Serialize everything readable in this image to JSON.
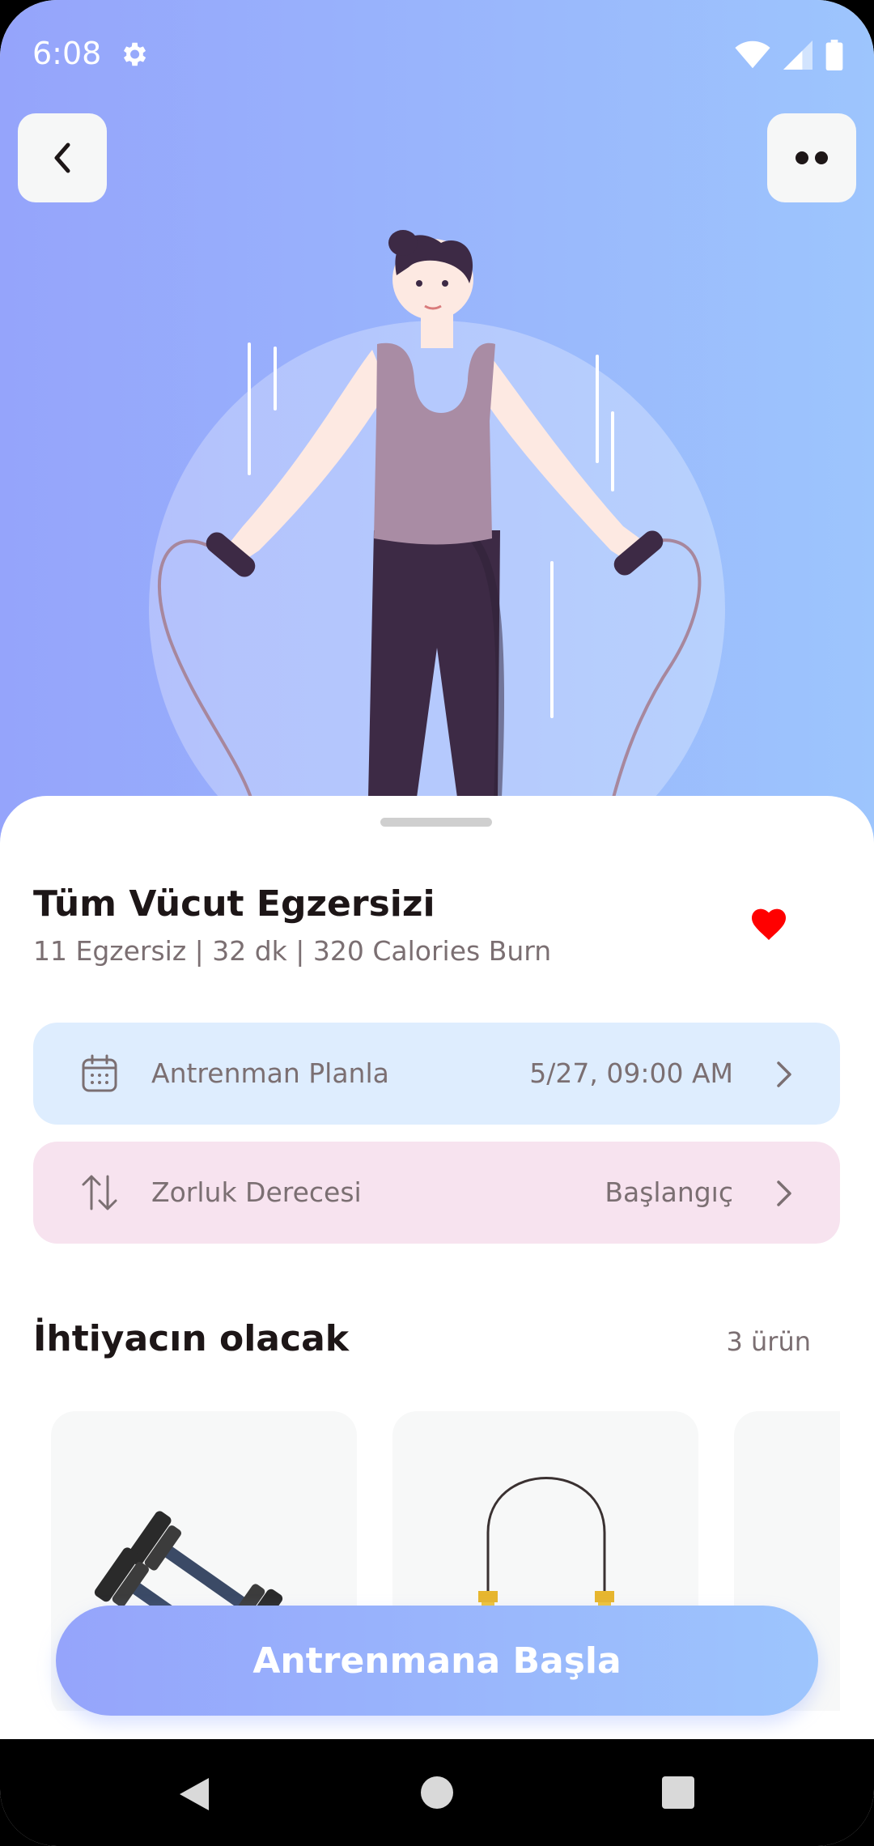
{
  "status_bar": {
    "time": "6:08",
    "icons": [
      "settings-icon",
      "wifi-icon",
      "signal-icon",
      "battery-icon"
    ]
  },
  "header": {
    "back_icon": "chevron-left-icon",
    "more_icon": "more-dots-icon"
  },
  "workout": {
    "title": "Tüm Vücut Egzersizi",
    "subtitle": "11 Egzersiz | 32 dk | 320 Calories Burn",
    "favorite_icon": "heart-icon",
    "favorite_color": "#ff0000"
  },
  "options": [
    {
      "icon": "calendar-icon",
      "label": "Antrenman Planla",
      "value": "5/27, 09:00 AM",
      "bg": "#deedfe"
    },
    {
      "icon": "sort-arrows-icon",
      "label": "Zorluk Derecesi",
      "value": "Başlangıç",
      "bg": "#f7e3ef"
    }
  ],
  "equipment": {
    "title": "İhtiyacın olacak",
    "count": "3 ürün",
    "items": [
      {
        "icon": "dumbbell-icon"
      },
      {
        "icon": "jump-rope-icon"
      },
      {
        "icon": "item-icon"
      }
    ]
  },
  "cta": {
    "label": "Antrenmana Başla"
  },
  "theme": {
    "gradient_start": "#95a4fb",
    "gradient_end": "#9dc5fd",
    "text_dark": "#1d1617",
    "text_gray": "#7b6f72"
  },
  "nav": {
    "back_icon": "nav-back-icon",
    "home_icon": "nav-home-icon",
    "recent_icon": "nav-recent-icon"
  }
}
